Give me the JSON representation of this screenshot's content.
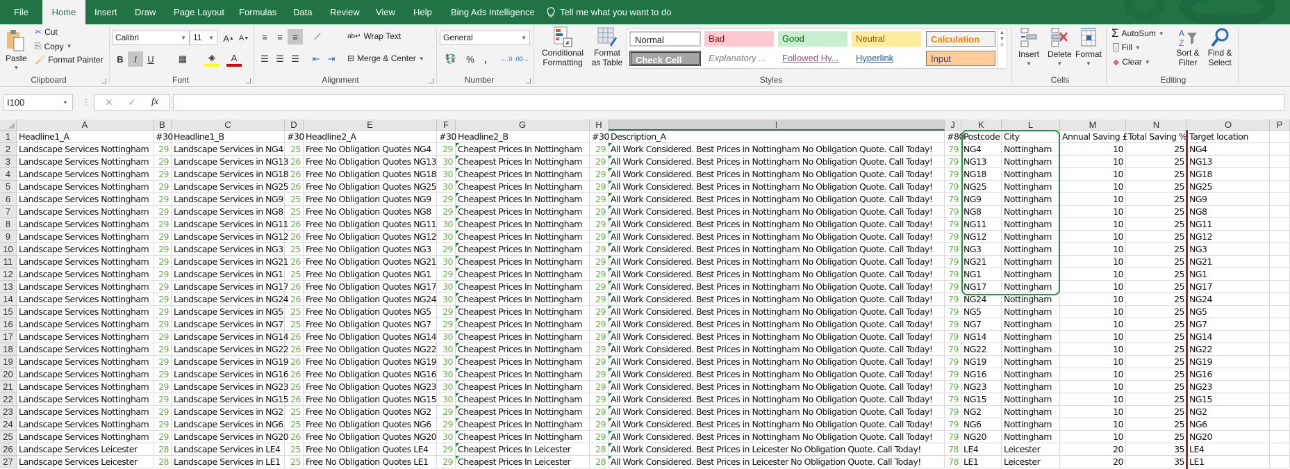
{
  "tabs": [
    {
      "label": "File",
      "active": false
    },
    {
      "label": "Home",
      "active": true
    },
    {
      "label": "Insert",
      "active": false
    },
    {
      "label": "Draw",
      "active": false
    },
    {
      "label": "Page Layout",
      "active": false
    },
    {
      "label": "Formulas",
      "active": false
    },
    {
      "label": "Data",
      "active": false
    },
    {
      "label": "Review",
      "active": false
    },
    {
      "label": "View",
      "active": false
    },
    {
      "label": "Help",
      "active": false
    },
    {
      "label": "Bing Ads Intelligence",
      "active": false
    }
  ],
  "tell_me": "Tell me what you want to do",
  "ribbon": {
    "clipboard": {
      "paste": "Paste",
      "cut": "Cut",
      "copy": "Copy",
      "format_painter": "Format Painter",
      "label": "Clipboard"
    },
    "font": {
      "name": "Calibri",
      "size": "11",
      "bold": "B",
      "italic": "I",
      "underline": "U",
      "label": "Font"
    },
    "alignment": {
      "wrap_text": "Wrap Text",
      "merge_center": "Merge & Center",
      "label": "Alignment"
    },
    "number": {
      "format": "General",
      "percent": "%",
      "comma": ",",
      "label": "Number"
    },
    "styles": {
      "conditional_formatting": "Conditional Formatting",
      "format_as_table": "Format as Table",
      "cells": [
        {
          "label": "Normal",
          "bg": "#ffffff",
          "fg": "#000000"
        },
        {
          "label": "Bad",
          "bg": "#ffc7ce",
          "fg": "#9c0006"
        },
        {
          "label": "Good",
          "bg": "#c6efce",
          "fg": "#006100"
        },
        {
          "label": "Neutral",
          "bg": "#ffeb9c",
          "fg": "#9c5700"
        },
        {
          "label": "Calculation",
          "bg": "#f2f2f2",
          "fg": "#fa7d00"
        },
        {
          "label": "Check Cell",
          "bg": "#a5a5a5",
          "fg": "#ffffff"
        },
        {
          "label": "Explanatory ...",
          "bg": "#ffffff",
          "fg": "#7f7f7f"
        },
        {
          "label": "Followed Hy...",
          "bg": "#ffffff",
          "fg": "#954f72"
        },
        {
          "label": "Hyperlink",
          "bg": "#ffffff",
          "fg": "#0563c1"
        },
        {
          "label": "Input",
          "bg": "#ffcc99",
          "fg": "#3f3f76"
        }
      ],
      "label": "Styles"
    },
    "cells": {
      "insert": "Insert",
      "delete": "Delete",
      "format": "Format",
      "label": "Cells"
    },
    "editing": {
      "autosum": "AutoSum",
      "fill": "Fill",
      "clear": "Clear",
      "sort_filter": "Sort & Filter",
      "find_select": "Find & Select",
      "label": "Editing"
    }
  },
  "formula_bar": {
    "name_box": "I100",
    "fx": "fx",
    "value": ""
  },
  "columns": [
    "A",
    "B",
    "C",
    "D",
    "E",
    "F",
    "G",
    "H",
    "I",
    "J",
    "K",
    "L",
    "M",
    "N",
    "O",
    "P"
  ],
  "selected_column": "I",
  "header_row": [
    "Headline1_A",
    "#30",
    "Headline1_B",
    "#30",
    "Headline2_A",
    "#30",
    "Headline2_B",
    "#30",
    "Description_A",
    "",
    "#80",
    "Postcode",
    "City",
    "Annual Saving £",
    "Total Saving %",
    "Target location"
  ],
  "rows": [
    {
      "a": "Landscape Services Nottingham",
      "b": 29,
      "c": "Landscape Services in NG4",
      "d": 25,
      "e": "Free No Obligation Quotes NG4",
      "f": 29,
      "g": "Cheapest Prices In Nottingham",
      "h": 29,
      "i": "All Work Considered. Best Prices in Nottingham No Obligation Quote. Call Today!",
      "j": 79,
      "k": "NG4",
      "l": "Nottingham",
      "m": 10,
      "n": 25,
      "o": "NG4"
    },
    {
      "a": "Landscape Services Nottingham",
      "b": 29,
      "c": "Landscape Services in NG13",
      "d": 26,
      "e": "Free No Obligation Quotes NG13",
      "f": 30,
      "g": "Cheapest Prices In Nottingham",
      "h": 29,
      "i": "All Work Considered. Best Prices in Nottingham No Obligation Quote. Call Today!",
      "j": 79,
      "k": "NG13",
      "l": "Nottingham",
      "m": 10,
      "n": 25,
      "o": "NG13"
    },
    {
      "a": "Landscape Services Nottingham",
      "b": 29,
      "c": "Landscape Services in NG18",
      "d": 26,
      "e": "Free No Obligation Quotes NG18",
      "f": 30,
      "g": "Cheapest Prices In Nottingham",
      "h": 29,
      "i": "All Work Considered. Best Prices in Nottingham No Obligation Quote. Call Today!",
      "j": 79,
      "k": "NG18",
      "l": "Nottingham",
      "m": 10,
      "n": 25,
      "o": "NG18"
    },
    {
      "a": "Landscape Services Nottingham",
      "b": 29,
      "c": "Landscape Services in NG25",
      "d": 26,
      "e": "Free No Obligation Quotes NG25",
      "f": 30,
      "g": "Cheapest Prices In Nottingham",
      "h": 29,
      "i": "All Work Considered. Best Prices in Nottingham No Obligation Quote. Call Today!",
      "j": 79,
      "k": "NG25",
      "l": "Nottingham",
      "m": 10,
      "n": 25,
      "o": "NG25"
    },
    {
      "a": "Landscape Services Nottingham",
      "b": 29,
      "c": "Landscape Services in NG9",
      "d": 25,
      "e": "Free No Obligation Quotes NG9",
      "f": 29,
      "g": "Cheapest Prices In Nottingham",
      "h": 29,
      "i": "All Work Considered. Best Prices in Nottingham No Obligation Quote. Call Today!",
      "j": 79,
      "k": "NG9",
      "l": "Nottingham",
      "m": 10,
      "n": 25,
      "o": "NG9"
    },
    {
      "a": "Landscape Services Nottingham",
      "b": 29,
      "c": "Landscape Services in NG8",
      "d": 25,
      "e": "Free No Obligation Quotes NG8",
      "f": 29,
      "g": "Cheapest Prices In Nottingham",
      "h": 29,
      "i": "All Work Considered. Best Prices in Nottingham No Obligation Quote. Call Today!",
      "j": 79,
      "k": "NG8",
      "l": "Nottingham",
      "m": 10,
      "n": 25,
      "o": "NG8"
    },
    {
      "a": "Landscape Services Nottingham",
      "b": 29,
      "c": "Landscape Services in NG11",
      "d": 26,
      "e": "Free No Obligation Quotes NG11",
      "f": 30,
      "g": "Cheapest Prices In Nottingham",
      "h": 29,
      "i": "All Work Considered. Best Prices in Nottingham No Obligation Quote. Call Today!",
      "j": 79,
      "k": "NG11",
      "l": "Nottingham",
      "m": 10,
      "n": 25,
      "o": "NG11"
    },
    {
      "a": "Landscape Services Nottingham",
      "b": 29,
      "c": "Landscape Services in NG12",
      "d": 26,
      "e": "Free No Obligation Quotes NG12",
      "f": 30,
      "g": "Cheapest Prices In Nottingham",
      "h": 29,
      "i": "All Work Considered. Best Prices in Nottingham No Obligation Quote. Call Today!",
      "j": 79,
      "k": "NG12",
      "l": "Nottingham",
      "m": 10,
      "n": 25,
      "o": "NG12"
    },
    {
      "a": "Landscape Services Nottingham",
      "b": 29,
      "c": "Landscape Services in NG3",
      "d": 25,
      "e": "Free No Obligation Quotes NG3",
      "f": 29,
      "g": "Cheapest Prices In Nottingham",
      "h": 29,
      "i": "All Work Considered. Best Prices in Nottingham No Obligation Quote. Call Today!",
      "j": 79,
      "k": "NG3",
      "l": "Nottingham",
      "m": 10,
      "n": 25,
      "o": "NG3"
    },
    {
      "a": "Landscape Services Nottingham",
      "b": 29,
      "c": "Landscape Services in NG21",
      "d": 26,
      "e": "Free No Obligation Quotes NG21",
      "f": 30,
      "g": "Cheapest Prices In Nottingham",
      "h": 29,
      "i": "All Work Considered. Best Prices in Nottingham No Obligation Quote. Call Today!",
      "j": 79,
      "k": "NG21",
      "l": "Nottingham",
      "m": 10,
      "n": 25,
      "o": "NG21"
    },
    {
      "a": "Landscape Services Nottingham",
      "b": 29,
      "c": "Landscape Services in NG1",
      "d": 25,
      "e": "Free No Obligation Quotes NG1",
      "f": 29,
      "g": "Cheapest Prices In Nottingham",
      "h": 29,
      "i": "All Work Considered. Best Prices in Nottingham No Obligation Quote. Call Today!",
      "j": 79,
      "k": "NG1",
      "l": "Nottingham",
      "m": 10,
      "n": 25,
      "o": "NG1"
    },
    {
      "a": "Landscape Services Nottingham",
      "b": 29,
      "c": "Landscape Services in NG17",
      "d": 26,
      "e": "Free No Obligation Quotes NG17",
      "f": 30,
      "g": "Cheapest Prices In Nottingham",
      "h": 29,
      "i": "All Work Considered. Best Prices in Nottingham No Obligation Quote. Call Today!",
      "j": 79,
      "k": "NG17",
      "l": "Nottingham",
      "m": 10,
      "n": 25,
      "o": "NG17"
    },
    {
      "a": "Landscape Services Nottingham",
      "b": 29,
      "c": "Landscape Services in NG24",
      "d": 26,
      "e": "Free No Obligation Quotes NG24",
      "f": 30,
      "g": "Cheapest Prices In Nottingham",
      "h": 29,
      "i": "All Work Considered. Best Prices in Nottingham No Obligation Quote. Call Today!",
      "j": 79,
      "k": "NG24",
      "l": "Nottingham",
      "m": 10,
      "n": 25,
      "o": "NG24"
    },
    {
      "a": "Landscape Services Nottingham",
      "b": 29,
      "c": "Landscape Services in NG5",
      "d": 25,
      "e": "Free No Obligation Quotes NG5",
      "f": 29,
      "g": "Cheapest Prices In Nottingham",
      "h": 29,
      "i": "All Work Considered. Best Prices in Nottingham No Obligation Quote. Call Today!",
      "j": 79,
      "k": "NG5",
      "l": "Nottingham",
      "m": 10,
      "n": 25,
      "o": "NG5"
    },
    {
      "a": "Landscape Services Nottingham",
      "b": 29,
      "c": "Landscape Services in NG7",
      "d": 25,
      "e": "Free No Obligation Quotes NG7",
      "f": 29,
      "g": "Cheapest Prices In Nottingham",
      "h": 29,
      "i": "All Work Considered. Best Prices in Nottingham No Obligation Quote. Call Today!",
      "j": 79,
      "k": "NG7",
      "l": "Nottingham",
      "m": 10,
      "n": 25,
      "o": "NG7"
    },
    {
      "a": "Landscape Services Nottingham",
      "b": 29,
      "c": "Landscape Services in NG14",
      "d": 26,
      "e": "Free No Obligation Quotes NG14",
      "f": 30,
      "g": "Cheapest Prices In Nottingham",
      "h": 29,
      "i": "All Work Considered. Best Prices in Nottingham No Obligation Quote. Call Today!",
      "j": 79,
      "k": "NG14",
      "l": "Nottingham",
      "m": 10,
      "n": 25,
      "o": "NG14"
    },
    {
      "a": "Landscape Services Nottingham",
      "b": 29,
      "c": "Landscape Services in NG22",
      "d": 26,
      "e": "Free No Obligation Quotes NG22",
      "f": 30,
      "g": "Cheapest Prices In Nottingham",
      "h": 29,
      "i": "All Work Considered. Best Prices in Nottingham No Obligation Quote. Call Today!",
      "j": 79,
      "k": "NG22",
      "l": "Nottingham",
      "m": 10,
      "n": 25,
      "o": "NG22"
    },
    {
      "a": "Landscape Services Nottingham",
      "b": 29,
      "c": "Landscape Services in NG19",
      "d": 26,
      "e": "Free No Obligation Quotes NG19",
      "f": 30,
      "g": "Cheapest Prices In Nottingham",
      "h": 29,
      "i": "All Work Considered. Best Prices in Nottingham No Obligation Quote. Call Today!",
      "j": 79,
      "k": "NG19",
      "l": "Nottingham",
      "m": 10,
      "n": 25,
      "o": "NG19"
    },
    {
      "a": "Landscape Services Nottingham",
      "b": 29,
      "c": "Landscape Services in NG16",
      "d": 26,
      "e": "Free No Obligation Quotes NG16",
      "f": 30,
      "g": "Cheapest Prices In Nottingham",
      "h": 29,
      "i": "All Work Considered. Best Prices in Nottingham No Obligation Quote. Call Today!",
      "j": 79,
      "k": "NG16",
      "l": "Nottingham",
      "m": 10,
      "n": 25,
      "o": "NG16"
    },
    {
      "a": "Landscape Services Nottingham",
      "b": 29,
      "c": "Landscape Services in NG23",
      "d": 26,
      "e": "Free No Obligation Quotes NG23",
      "f": 30,
      "g": "Cheapest Prices In Nottingham",
      "h": 29,
      "i": "All Work Considered. Best Prices in Nottingham No Obligation Quote. Call Today!",
      "j": 79,
      "k": "NG23",
      "l": "Nottingham",
      "m": 10,
      "n": 25,
      "o": "NG23"
    },
    {
      "a": "Landscape Services Nottingham",
      "b": 29,
      "c": "Landscape Services in NG15",
      "d": 26,
      "e": "Free No Obligation Quotes NG15",
      "f": 30,
      "g": "Cheapest Prices In Nottingham",
      "h": 29,
      "i": "All Work Considered. Best Prices in Nottingham No Obligation Quote. Call Today!",
      "j": 79,
      "k": "NG15",
      "l": "Nottingham",
      "m": 10,
      "n": 25,
      "o": "NG15"
    },
    {
      "a": "Landscape Services Nottingham",
      "b": 29,
      "c": "Landscape Services in NG2",
      "d": 25,
      "e": "Free No Obligation Quotes NG2",
      "f": 29,
      "g": "Cheapest Prices In Nottingham",
      "h": 29,
      "i": "All Work Considered. Best Prices in Nottingham No Obligation Quote. Call Today!",
      "j": 79,
      "k": "NG2",
      "l": "Nottingham",
      "m": 10,
      "n": 25,
      "o": "NG2"
    },
    {
      "a": "Landscape Services Nottingham",
      "b": 29,
      "c": "Landscape Services in NG6",
      "d": 25,
      "e": "Free No Obligation Quotes NG6",
      "f": 29,
      "g": "Cheapest Prices In Nottingham",
      "h": 29,
      "i": "All Work Considered. Best Prices in Nottingham No Obligation Quote. Call Today!",
      "j": 79,
      "k": "NG6",
      "l": "Nottingham",
      "m": 10,
      "n": 25,
      "o": "NG6"
    },
    {
      "a": "Landscape Services Nottingham",
      "b": 29,
      "c": "Landscape Services in NG20",
      "d": 26,
      "e": "Free No Obligation Quotes NG20",
      "f": 30,
      "g": "Cheapest Prices In Nottingham",
      "h": 29,
      "i": "All Work Considered. Best Prices in Nottingham No Obligation Quote. Call Today!",
      "j": 79,
      "k": "NG20",
      "l": "Nottingham",
      "m": 10,
      "n": 25,
      "o": "NG20"
    },
    {
      "a": "Landscape Services Leicester",
      "b": 28,
      "c": "Landscape Services in LE4",
      "d": 25,
      "e": "Free No Obligation Quotes LE4",
      "f": 29,
      "g": "Cheapest Prices In Leicester",
      "h": 28,
      "i": "All Work Considered. Best Prices in Leicester No Obligation Quote. Call Today!",
      "j": 78,
      "k": "LE4",
      "l": "Leicester",
      "m": 20,
      "n": 35,
      "o": "LE4"
    },
    {
      "a": "Landscape Services Leicester",
      "b": 28,
      "c": "Landscape Services in LE1",
      "d": 25,
      "e": "Free No Obligation Quotes LE1",
      "f": 29,
      "g": "Cheapest Prices In Leicester",
      "h": 28,
      "i": "All Work Considered. Best Prices in Leicester No Obligation Quote. Call Today!",
      "j": 78,
      "k": "LE1",
      "l": "Leicester",
      "m": 20,
      "n": 35,
      "o": "LE1"
    }
  ]
}
